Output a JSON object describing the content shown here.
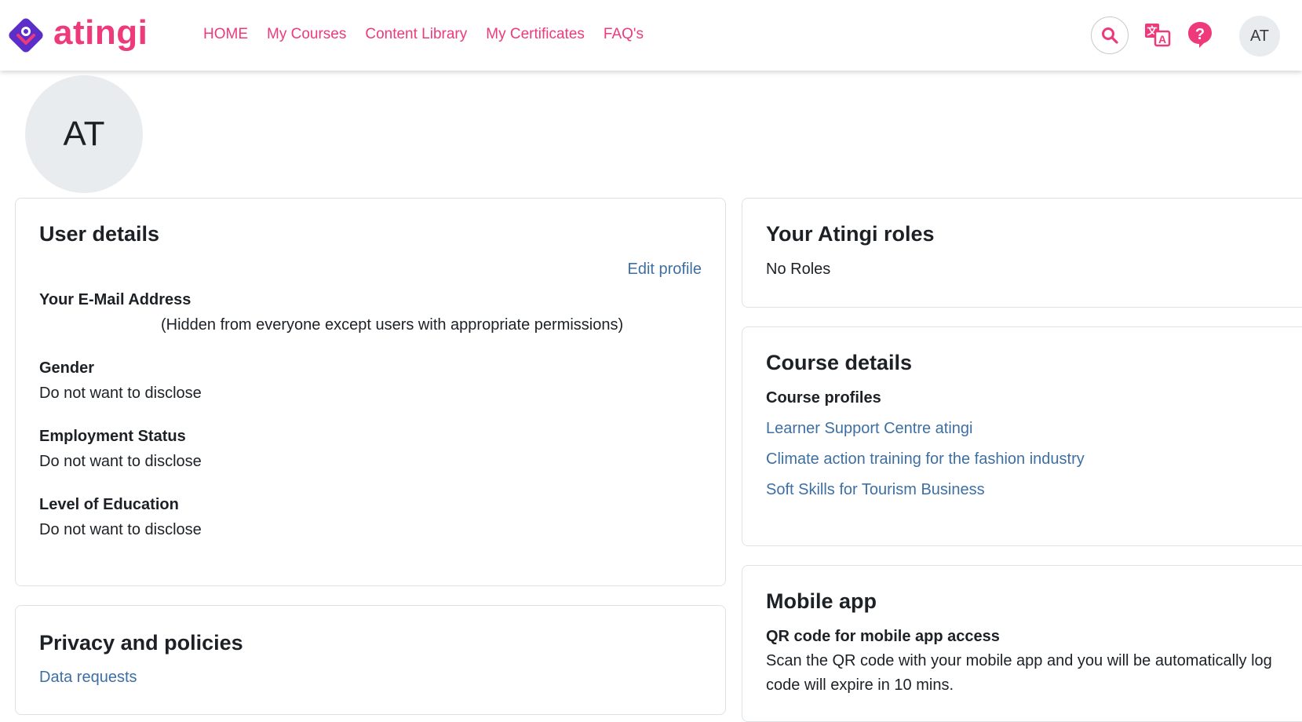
{
  "brand": {
    "name": "atingi",
    "primary_color": "#ee3a7b",
    "logo_diamond_color": "#5b2ec9",
    "link_color": "#3e6fa3"
  },
  "nav": {
    "links": [
      "HOME",
      "My Courses",
      "Content Library",
      "My Certificates",
      "FAQ's"
    ],
    "search_icon": "search-icon",
    "language_icon": "translate-icon",
    "help_icon": "help-icon",
    "user_initials": "AT"
  },
  "profile": {
    "initials": "AT"
  },
  "user_details": {
    "title": "User details",
    "edit_profile": "Edit profile",
    "email_label": "Your E-Mail Address",
    "email_note": "(Hidden from everyone except users with appropriate permissions)",
    "gender_label": "Gender",
    "gender_value": "Do not want to disclose",
    "employment_label": "Employment Status",
    "employment_value": "Do not want to disclose",
    "education_label": "Level of Education",
    "education_value": "Do not want to disclose"
  },
  "privacy": {
    "title": "Privacy and policies",
    "data_requests": "Data requests"
  },
  "roles": {
    "title": "Your Atingi roles",
    "value": "No Roles"
  },
  "course_details": {
    "title": "Course details",
    "profiles_label": "Course profiles",
    "courses": [
      "Learner Support Centre atingi",
      "Climate action training for the fashion industry",
      "Soft Skills for Tourism Business"
    ]
  },
  "mobile_app": {
    "title": "Mobile app",
    "qr_label": "QR code for mobile app access",
    "qr_text_line1": "Scan the QR code with your mobile app and you will be automatically log",
    "qr_text_line2": "code will expire in 10 mins."
  }
}
